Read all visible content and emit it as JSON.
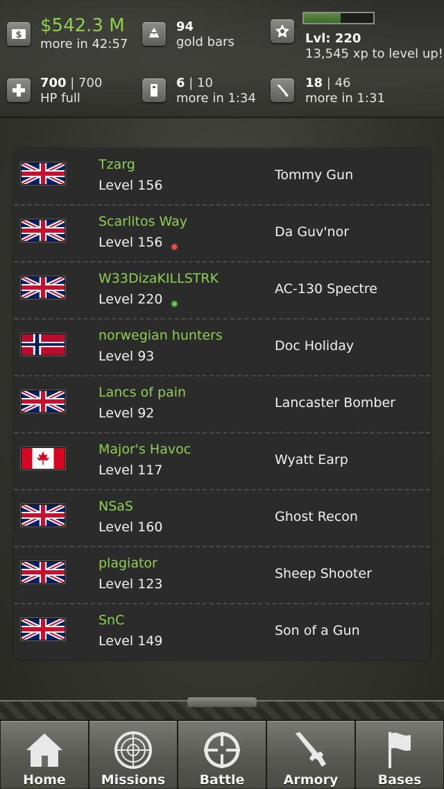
{
  "hud": {
    "cash": {
      "icon": "dollar-icon",
      "value": "$542.3 M",
      "sub": "more in 42:57"
    },
    "gold": {
      "icon": "gold-bars-icon",
      "value": "94",
      "sub": "gold bars"
    },
    "level": {
      "icon": "level-badge-icon",
      "value": "Lvl: 220",
      "sub": "13,545 xp to level up!",
      "xp_progress": 0.53
    },
    "hp": {
      "icon": "health-cross-icon",
      "current": "700",
      "sep": " | ",
      "max": "700",
      "sub": "HP full"
    },
    "energy": {
      "icon": "energy-canister-icon",
      "current": "6",
      "sep": " | ",
      "max": "10",
      "sub": "more in 1:34"
    },
    "stamina": {
      "icon": "stamina-blade-icon",
      "current": "18",
      "sep": " | ",
      "max": "46",
      "sub": "more in 1:31"
    }
  },
  "players": [
    {
      "flag": "uk",
      "name": "Tzarg",
      "level": "Level 156",
      "title": "Tommy Gun",
      "status": ""
    },
    {
      "flag": "uk",
      "name": "Scarlitos Way",
      "level": "Level 156",
      "title": "Da Guv'nor",
      "status": "red"
    },
    {
      "flag": "uk",
      "name": "W33DizaKILLSTRK",
      "level": "Level 220",
      "title": "AC-130 Spectre",
      "status": "green"
    },
    {
      "flag": "norway",
      "name": "norwegian hunters",
      "level": "Level 93",
      "title": "Doc Holiday",
      "status": ""
    },
    {
      "flag": "uk",
      "name": "Lancs of pain",
      "level": "Level 92",
      "title": "Lancaster Bomber",
      "status": ""
    },
    {
      "flag": "canada",
      "name": "Major's Havoc",
      "level": "Level 117",
      "title": "Wyatt Earp",
      "status": ""
    },
    {
      "flag": "uk",
      "name": "NSaS",
      "level": "Level 160",
      "title": "Ghost Recon",
      "status": ""
    },
    {
      "flag": "uk",
      "name": "plagiator",
      "level": "Level 123",
      "title": "Sheep Shooter",
      "status": ""
    },
    {
      "flag": "uk",
      "name": "SnC",
      "level": "Level 149",
      "title": "Son of a Gun",
      "status": ""
    }
  ],
  "tabs": [
    {
      "label": "Home",
      "icon": "home-icon"
    },
    {
      "label": "Missions",
      "icon": "radar-icon"
    },
    {
      "label": "Battle",
      "icon": "crosshair-icon"
    },
    {
      "label": "Armory",
      "icon": "rifle-icon"
    },
    {
      "label": "Bases",
      "icon": "flag-icon"
    }
  ],
  "colors": {
    "accent_green": "#8fd14f",
    "panel": "#2b2b2c",
    "status_red": "#ff4b4b",
    "status_green": "#5bd24a"
  }
}
